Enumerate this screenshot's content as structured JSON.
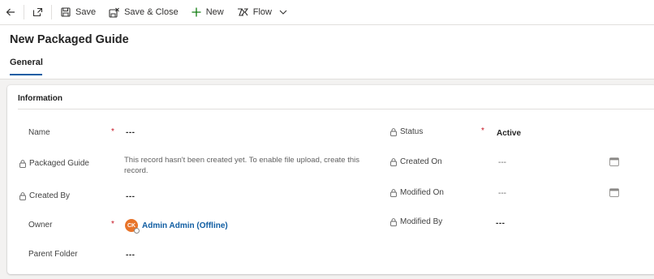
{
  "toolbar": {
    "back_icon": "back-arrow-icon",
    "popout_icon": "pop-out-icon",
    "save_label": "Save",
    "save_close_label": "Save & Close",
    "new_label": "New",
    "flow_label": "Flow"
  },
  "form": {
    "title": "New Packaged Guide",
    "tabs": [
      {
        "label": "General",
        "selected": true
      }
    ],
    "accent_color": "#115ea3"
  },
  "section": {
    "title": "Information",
    "left_fields": [
      {
        "label": "Name",
        "value": "---",
        "required": true,
        "locked": false
      },
      {
        "label": "Packaged Guide",
        "value": "This record hasn't been created yet. To enable file upload, create this record.",
        "required": false,
        "locked": true
      },
      {
        "label": "Created By",
        "value": "---",
        "required": false,
        "locked": true
      },
      {
        "label": "Owner",
        "value": "Admin Admin (Offline)",
        "avatar_initials": "CK",
        "required": true,
        "locked": false
      },
      {
        "label": "Parent Folder",
        "value": "---",
        "required": false,
        "locked": false
      }
    ],
    "right_fields": [
      {
        "label": "Status",
        "value": "Active",
        "required": true,
        "locked": true
      },
      {
        "label": "Created On",
        "value": "---",
        "locked": true,
        "icon": "calendar-icon"
      },
      {
        "label": "Modified On",
        "value": "---",
        "locked": true,
        "icon": "calendar-icon"
      },
      {
        "label": "Modified By",
        "value": "---",
        "locked": true
      }
    ]
  }
}
